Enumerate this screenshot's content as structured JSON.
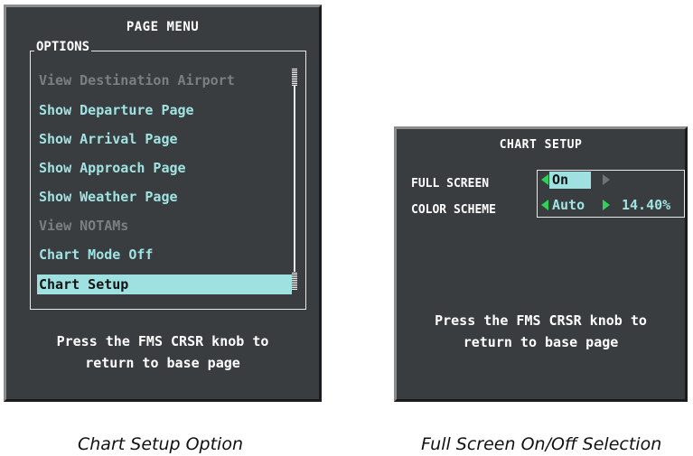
{
  "page_menu": {
    "title": "PAGE MENU",
    "options_label": "OPTIONS",
    "items": [
      {
        "label": "View Destination Airport",
        "state": "disabled"
      },
      {
        "label": "Show Departure Page",
        "state": "enabled"
      },
      {
        "label": "Show Arrival Page",
        "state": "enabled"
      },
      {
        "label": "Show Approach Page",
        "state": "enabled"
      },
      {
        "label": "Show Weather Page",
        "state": "enabled"
      },
      {
        "label": "View NOTAMs",
        "state": "disabled"
      },
      {
        "label": "Chart Mode Off",
        "state": "enabled"
      },
      {
        "label": "Chart Setup",
        "state": "selected"
      }
    ],
    "footer": "Press the FMS CRSR knob to\nreturn to base page"
  },
  "chart_setup": {
    "title": "CHART SETUP",
    "full_screen_label": "FULL SCREEN",
    "full_screen_value": "On",
    "color_scheme_label": "COLOR SCHEME",
    "color_scheme_value": "Auto",
    "color_scheme_percent": "14.40%",
    "footer": "Press the FMS CRSR knob to\nreturn to base page"
  },
  "captions": {
    "left": "Chart Setup Option",
    "right": "Full Screen On/Off Selection"
  },
  "colors": {
    "panel_bg": "#3a3d3f",
    "menu_text": "#9fe3e3",
    "disabled_text": "#7c7f81",
    "highlight": "#9fe0e0",
    "arrow_green": "#2fd15a"
  },
  "icons": [
    "left-arrow-icon",
    "right-arrow-icon",
    "scrollbar-thumb-icon"
  ]
}
